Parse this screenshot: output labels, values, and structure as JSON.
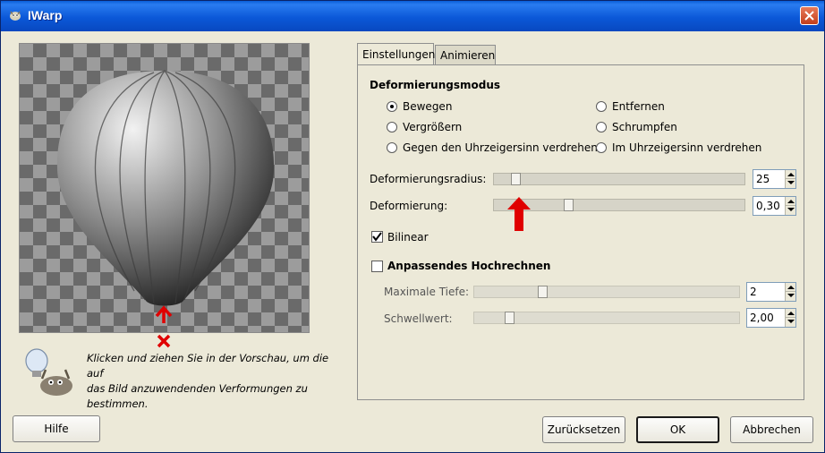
{
  "window": {
    "title": "IWarp"
  },
  "hint": {
    "text": "Klicken und ziehen Sie in der Vorschau, um die auf\ndas Bild anzuwendenden Verformungen zu\nbestimmen."
  },
  "tabs": [
    {
      "label": "Einstellungen",
      "active": true
    },
    {
      "label": "Animieren",
      "active": false
    }
  ],
  "mode": {
    "heading": "Deformierungsmodus",
    "options": [
      {
        "label": "Bewegen",
        "selected": true
      },
      {
        "label": "Entfernen",
        "selected": false
      },
      {
        "label": "Vergrößern",
        "selected": false
      },
      {
        "label": "Schrumpfen",
        "selected": false
      },
      {
        "label": "Gegen den Uhrzeigersinn verdrehen",
        "selected": false
      },
      {
        "label": "Im Uhrzeigersinn verdrehen",
        "selected": false
      }
    ]
  },
  "radius": {
    "label": "Deformierungsradius:",
    "value": "25",
    "fraction": 0.07
  },
  "amount": {
    "label": "Deformierung:",
    "value": "0,30",
    "fraction": 0.29
  },
  "bilinear": {
    "label": "Bilinear",
    "checked": true
  },
  "adaptive": {
    "label": "Anpassendes Hochrechnen",
    "checked": false,
    "depth": {
      "label": "Maximale Tiefe:",
      "value": "2",
      "fraction": 0.25
    },
    "threshold": {
      "label": "Schwellwert:",
      "value": "2,00",
      "fraction": 0.12
    }
  },
  "buttons": {
    "help": "Hilfe",
    "reset": "Zurücksetzen",
    "ok": "OK",
    "cancel": "Abbrechen"
  },
  "colors": {
    "titlebar": "#0b58d8",
    "annotation": "#e00000",
    "dialog": "#ece9d8"
  }
}
